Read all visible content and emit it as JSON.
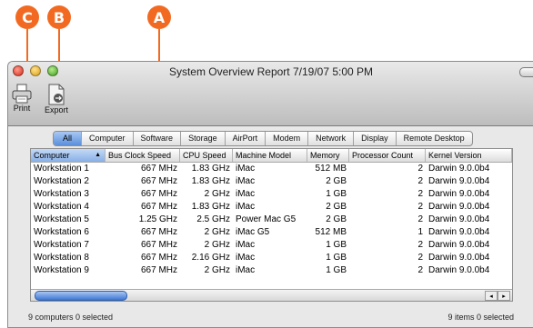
{
  "callouts": {
    "a": "A",
    "b": "B",
    "c": "C"
  },
  "window": {
    "title": "System Overview Report  7/19/07 5:00 PM"
  },
  "toolbar": {
    "print_label": "Print",
    "export_label": "Export"
  },
  "tabs": [
    "All",
    "Computer",
    "Software",
    "Storage",
    "AirPort",
    "Modem",
    "Network",
    "Display",
    "Remote Desktop"
  ],
  "active_tab": "All",
  "table": {
    "columns": [
      "Computer",
      "Bus Clock Speed",
      "CPU Speed",
      "Machine Model",
      "Memory",
      "Processor Count",
      "Kernel Version"
    ],
    "sorted_column": "Computer",
    "sort_indicator": "▲",
    "rows": [
      [
        "Workstation 1",
        "667 MHz",
        "1.83 GHz",
        "iMac",
        "512 MB",
        "2",
        "Darwin 9.0.0b4"
      ],
      [
        "Workstation 2",
        "667 MHz",
        "1.83 GHz",
        "iMac",
        "2 GB",
        "2",
        "Darwin 9.0.0b4"
      ],
      [
        "Workstation 3",
        "667 MHz",
        "2 GHz",
        "iMac",
        "1 GB",
        "2",
        "Darwin 9.0.0b4"
      ],
      [
        "Workstation 4",
        "667 MHz",
        "1.83 GHz",
        "iMac",
        "2 GB",
        "2",
        "Darwin 9.0.0b4"
      ],
      [
        "Workstation 5",
        "1.25 GHz",
        "2.5 GHz",
        "Power Mac G5",
        "2 GB",
        "2",
        "Darwin 9.0.0b4"
      ],
      [
        "Workstation 6",
        "667 MHz",
        "2 GHz",
        "iMac G5",
        "512 MB",
        "1",
        "Darwin 9.0.0b4"
      ],
      [
        "Workstation 7",
        "667 MHz",
        "2 GHz",
        "iMac",
        "1 GB",
        "2",
        "Darwin 9.0.0b4"
      ],
      [
        "Workstation 8",
        "667 MHz",
        "2.16 GHz",
        "iMac",
        "1 GB",
        "2",
        "Darwin 9.0.0b4"
      ],
      [
        "Workstation 9",
        "667 MHz",
        "2 GHz",
        "iMac",
        "1 GB",
        "2",
        "Darwin 9.0.0b4"
      ]
    ]
  },
  "scroll_arrows": {
    "left": "◂",
    "right": "▸"
  },
  "status": {
    "left": "9 computers  0 selected",
    "right": "9 items  0 selected"
  },
  "colors": {
    "callout": "#f26a21",
    "selection": "#5a8fdc"
  }
}
